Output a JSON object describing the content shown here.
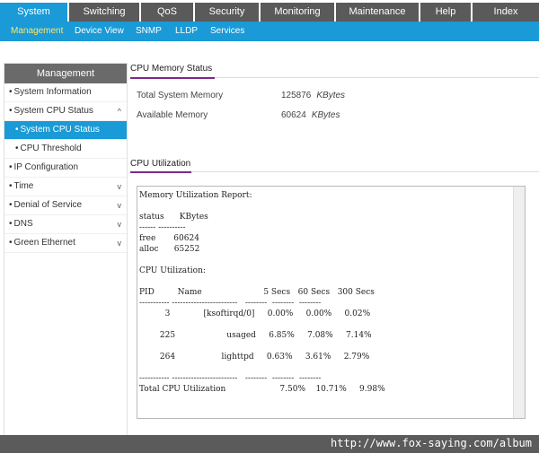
{
  "topnav": {
    "tabs": [
      {
        "label": "System"
      },
      {
        "label": "Switching"
      },
      {
        "label": "QoS"
      },
      {
        "label": "Security"
      },
      {
        "label": "Monitoring"
      },
      {
        "label": "Maintenance"
      },
      {
        "label": "Help"
      },
      {
        "label": "Index"
      }
    ],
    "active_index": 0
  },
  "subnav": {
    "items": [
      {
        "label": "Management"
      },
      {
        "label": "Device View"
      },
      {
        "label": "SNMP"
      },
      {
        "label": "LLDP"
      },
      {
        "label": "Services"
      }
    ],
    "active_index": 0
  },
  "sidebar": {
    "title": "Management",
    "items": [
      {
        "label": "System Information"
      },
      {
        "label": "System CPU Status"
      },
      {
        "label": "System CPU Status"
      },
      {
        "label": "CPU Threshold"
      },
      {
        "label": "IP Configuration"
      },
      {
        "label": "Time"
      },
      {
        "label": "Denial of Service"
      },
      {
        "label": "DNS"
      },
      {
        "label": "Green Ethernet"
      }
    ],
    "bullet": "•",
    "chevron_up": "^",
    "chevron_down": "v"
  },
  "memory": {
    "title": "CPU Memory Status",
    "total_label": "Total System Memory",
    "total_value": "125876",
    "total_unit": "KBytes",
    "avail_label": "Available Memory",
    "avail_value": "60624",
    "avail_unit": "KBytes"
  },
  "cpu": {
    "title": "CPU Utilization",
    "report_text": "Memory Utilization Report:\n\nstatus      KBytes\n------ ----------\nfree       60624\nalloc      65252\n\nCPU Utilization:\n\nPID         Name                        5 Secs   60 Secs   300 Secs\n----------- ------------------------   --------  --------  --------\n          3             [ksoftirqd/0]     0.00%     0.00%     0.02%\n\n        225                    usaged     6.85%     7.08%     7.14%\n\n        264                  lighttpd     0.63%     3.61%     2.79%\n\n----------- ------------------------   --------  --------  --------\nTotal CPU Utilization                     7.50%    10.71%     9.98%"
  },
  "footer": {
    "url": "http://www.fox-saying.com/album"
  }
}
